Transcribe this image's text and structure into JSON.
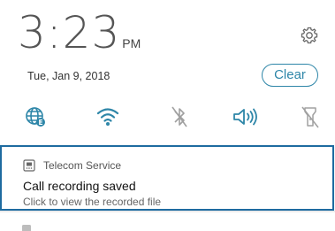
{
  "status": {
    "time": "3:23",
    "ampm": "PM",
    "date": "Tue, Jan 9, 2018"
  },
  "header": {
    "settings_icon": "gear-icon",
    "clear_label": "Clear"
  },
  "quick_settings": [
    {
      "name": "globe-e-icon",
      "state": "on"
    },
    {
      "name": "wifi-icon",
      "state": "on"
    },
    {
      "name": "bluetooth-icon",
      "state": "off"
    },
    {
      "name": "sound-icon",
      "state": "on"
    },
    {
      "name": "flashlight-icon",
      "state": "off"
    }
  ],
  "notification": {
    "app_name": "Telecom Service",
    "title": "Call recording saved",
    "body": "Click to view the recorded file"
  },
  "colors": {
    "accent": "#2e86a8",
    "selection_border": "#1e6ba0"
  }
}
